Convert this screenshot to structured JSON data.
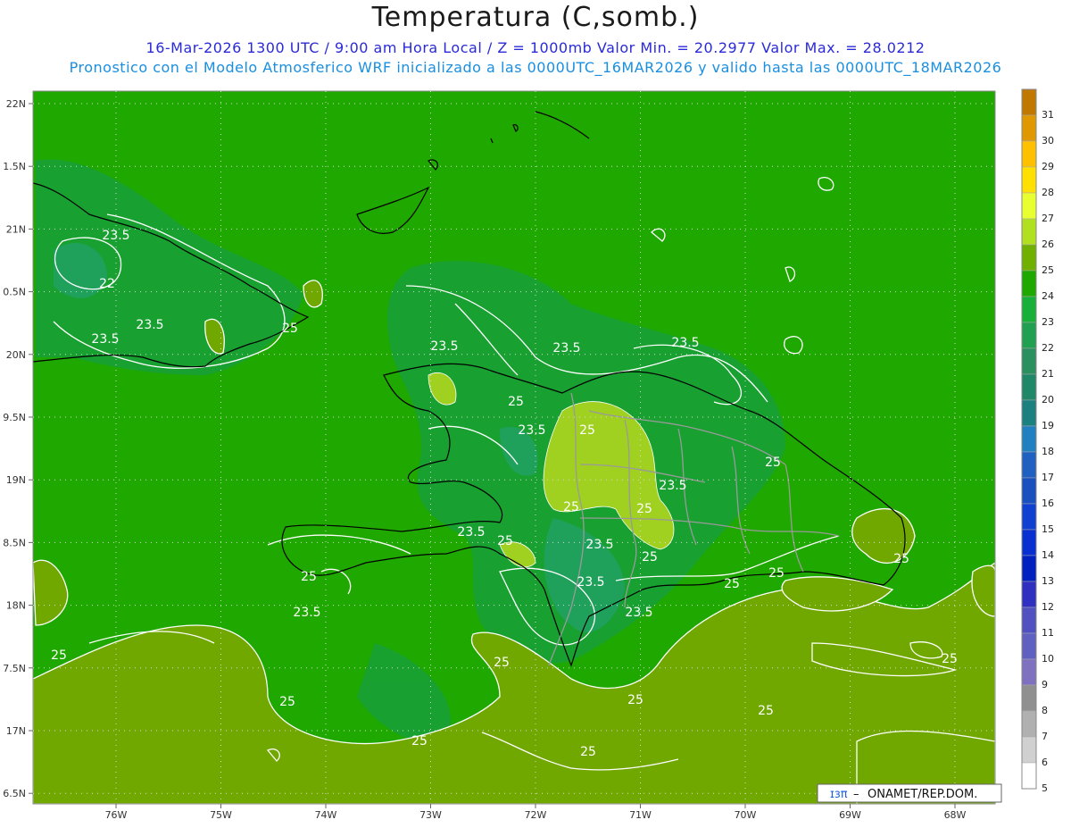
{
  "header": {
    "title": "Temperatura (C,somb.)",
    "line1": "16-Mar-2026  1300 UTC / 9:00 am Hora Local / Z = 1000mb   Valor Min. = 20.2977  Valor Max. = 28.0212",
    "line2": "Pronostico con el Modelo Atmosferico WRF inicializado a las 0000UTC_16MAR2026 y valido hasta las  0000UTC_18MAR2026"
  },
  "axes": {
    "lon_labels": [
      "76W",
      "75W",
      "74W",
      "73W",
      "72W",
      "71W",
      "70W",
      "69W",
      "68W"
    ],
    "lat_labels": [
      "22N",
      "1.5N",
      "21N",
      "0.5N",
      "20N",
      "9.5N",
      "19N",
      "8.5N",
      "18N",
      "7.5N",
      "17N",
      "6.5N"
    ]
  },
  "contour_labels": [
    "23.5",
    "22",
    "23.5",
    "23.5",
    "25",
    "23.5",
    "25",
    "23.5",
    "23.5",
    "23.5",
    "25",
    "25",
    "23.5",
    "23.5",
    "23.5",
    "25",
    "25",
    "23.5",
    "25",
    "23.5",
    "25",
    "25",
    "23.5",
    "25",
    "25",
    "25",
    "25",
    "25",
    "25",
    "25",
    "25",
    "25",
    "25"
  ],
  "colorbar": {
    "labels": [
      "31",
      "30",
      "29",
      "28",
      "27",
      "26",
      "25",
      "24",
      "23",
      "22",
      "21",
      "20",
      "19",
      "18",
      "17",
      "16",
      "15",
      "14",
      "13",
      "12",
      "11",
      "10",
      "9",
      "8",
      "7",
      "6",
      "5"
    ],
    "colors": [
      "#c07800",
      "#e09800",
      "#ffc000",
      "#ffe000",
      "#e8ff30",
      "#b0e020",
      "#70b000",
      "#1fa800",
      "#18b038",
      "#20a050",
      "#2a9060",
      "#208868",
      "#1a8080",
      "#2080c0",
      "#2060c0",
      "#1850c0",
      "#1040d0",
      "#0830d0",
      "#0020c0",
      "#3030c0",
      "#5050c0",
      "#6060c0",
      "#8070c0",
      "#909090",
      "#b0b0b0",
      "#d0d0d0",
      "#ffffff"
    ]
  },
  "credit": "ONAMET/REP.DOM.",
  "credit_logo": "ɪɜπ"
}
